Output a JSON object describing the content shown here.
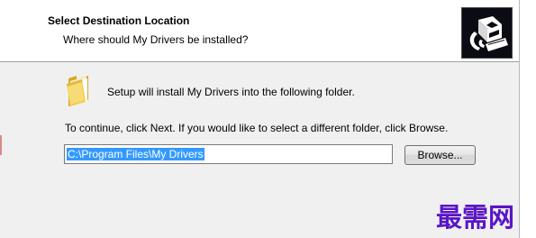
{
  "header": {
    "title": "Select Destination Location",
    "subtitle": "Where should My Drivers be installed?"
  },
  "main": {
    "install_message": "Setup will install My Drivers into the following folder.",
    "continue_message": "To continue, click Next. If you would like to select a different folder, click Browse.",
    "path_value": "C:\\Program Files\\My Drivers",
    "browse_label": "Browse..."
  },
  "watermark": {
    "text": "最需网"
  },
  "icons": {
    "folder": "folder-icon",
    "setup_logo": "setup-logo-icon"
  },
  "colors": {
    "selection_highlight": "#3399ff",
    "watermark": "#5a15c6",
    "logo_background": "#0b0b14"
  }
}
